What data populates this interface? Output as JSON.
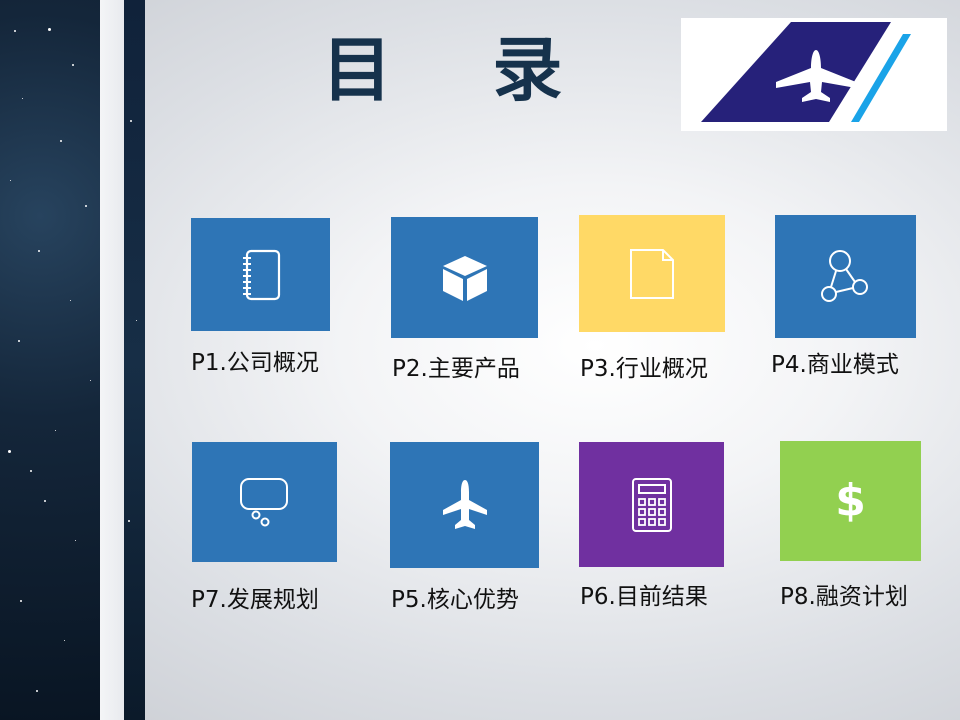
{
  "title": "目 录",
  "colors": {
    "blue_tile": "#2e75b6",
    "yellow_tile": "#ffd966",
    "purple_tile": "#7030a0",
    "green_tile": "#92d050",
    "title_color": "#16324c",
    "logo_navy": "#26217a",
    "logo_cyan": "#1aa3e8"
  },
  "items": [
    {
      "label": "P1.公司概况",
      "icon": "notebook-icon"
    },
    {
      "label": "P2.主要产品",
      "icon": "cube-icon"
    },
    {
      "label": "P3.行业概况",
      "icon": "document-icon"
    },
    {
      "label": "P4.商业模式",
      "icon": "network-nodes-icon"
    },
    {
      "label": "P7.发展规划",
      "icon": "thought-bubble-icon"
    },
    {
      "label": "P5.核心优势",
      "icon": "airplane-icon"
    },
    {
      "label": "P6.目前结果",
      "icon": "calculator-icon"
    },
    {
      "label": "P8.融资计划",
      "icon": "dollar-icon"
    }
  ],
  "dollar_glyph": "$"
}
